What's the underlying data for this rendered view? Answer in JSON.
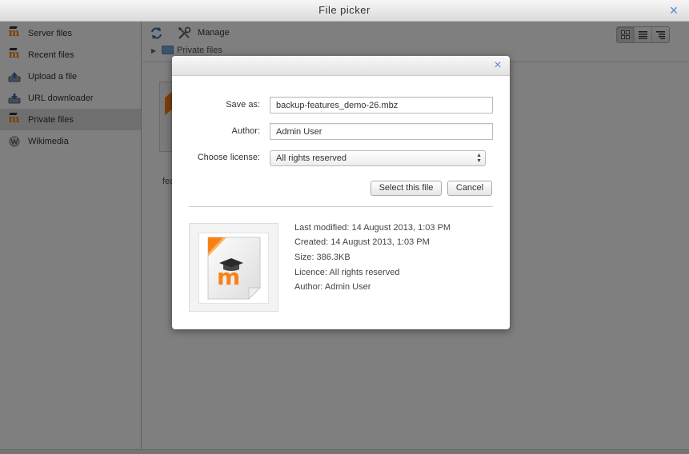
{
  "window": {
    "title": "File picker",
    "close_label": "×"
  },
  "sidebar": {
    "items": [
      {
        "label": "Server files",
        "icon": "moodle-icon"
      },
      {
        "label": "Recent files",
        "icon": "moodle-icon"
      },
      {
        "label": "Upload a file",
        "icon": "upload-icon"
      },
      {
        "label": "URL downloader",
        "icon": "url-icon"
      },
      {
        "label": "Private files",
        "icon": "moodle-icon",
        "active": true
      },
      {
        "label": "Wikimedia",
        "icon": "wikimedia-icon"
      }
    ]
  },
  "toolbar": {
    "refresh_icon": "refresh-icon",
    "manage_label": "Manage",
    "view_modes": [
      "icons-view",
      "list-view",
      "tree-view"
    ],
    "active_view": "icons-view"
  },
  "path": {
    "folder_label": "Private files"
  },
  "files_area": {
    "truncated_label": "fea"
  },
  "dialog": {
    "close_label": "×",
    "save_as_label": "Save as:",
    "save_as_value": "backup-features_demo-26.mbz",
    "author_label": "Author:",
    "author_value": "Admin User",
    "license_label": "Choose license:",
    "license_value": "All rights reserved",
    "select_button": "Select this file",
    "cancel_button": "Cancel",
    "info": {
      "last_modified": "Last modified: 14 August 2013, 1:03 PM",
      "created": "Created: 14 August 2013, 1:03 PM",
      "size": "Size: 386.3KB",
      "licence": "Licence: All rights reserved",
      "author": "Author: Admin User"
    }
  },
  "colors": {
    "moodle_orange": "#f98012",
    "accent_blue": "#5a86c9"
  }
}
